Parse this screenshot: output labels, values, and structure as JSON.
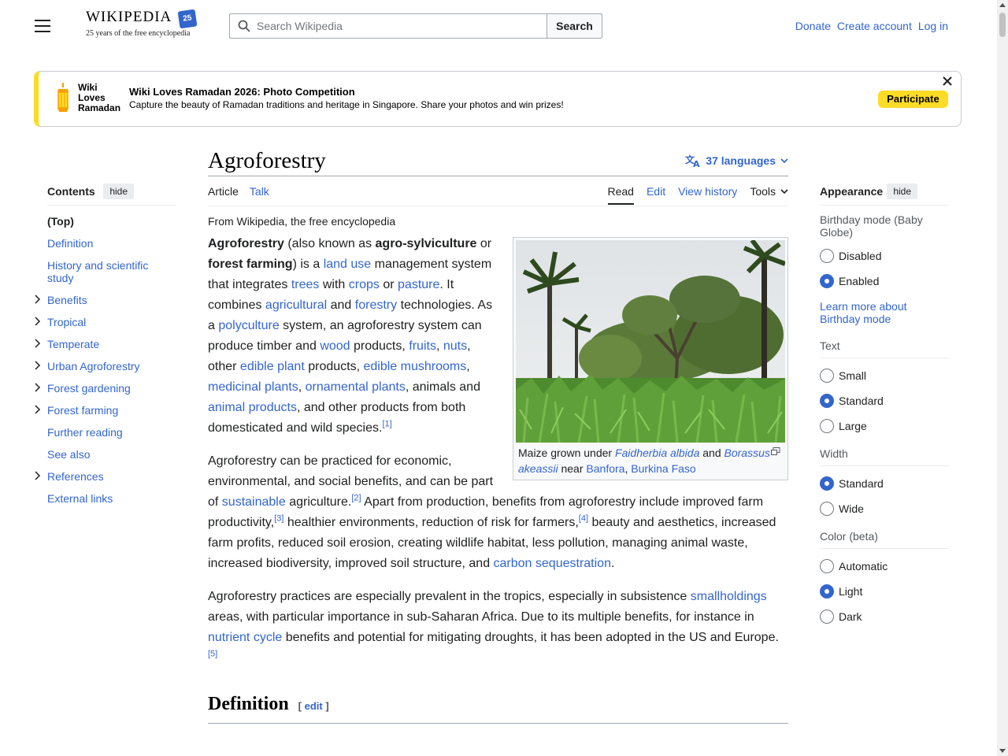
{
  "header": {
    "logo_word": "Wikipedia",
    "logo_tagline": "25 years of the free encyclopedia",
    "logo_badge": "25",
    "search_placeholder": "Search Wikipedia",
    "search_button": "Search",
    "user_links": [
      "Donate",
      "Create account",
      "Log in"
    ]
  },
  "banner": {
    "logo_lines": [
      "Wiki",
      "Loves",
      "Ramadan"
    ],
    "title": "Wiki Loves Ramadan 2026: Photo Competition",
    "description": "Capture the beauty of Ramadan traditions and heritage in Singapore. Share your photos and win prizes!",
    "button": "Participate"
  },
  "toc": {
    "title": "Contents",
    "hide": "hide",
    "items": [
      {
        "label": "(Top)",
        "expandable": false
      },
      {
        "label": "Definition",
        "expandable": false
      },
      {
        "label": "History and scientific study",
        "expandable": false
      },
      {
        "label": "Benefits",
        "expandable": true
      },
      {
        "label": "Tropical",
        "expandable": true
      },
      {
        "label": "Temperate",
        "expandable": true
      },
      {
        "label": "Urban Agroforestry",
        "expandable": true
      },
      {
        "label": "Forest gardening",
        "expandable": true
      },
      {
        "label": "Forest farming",
        "expandable": true
      },
      {
        "label": "Further reading",
        "expandable": false
      },
      {
        "label": "See also",
        "expandable": false
      },
      {
        "label": "References",
        "expandable": true
      },
      {
        "label": "External links",
        "expandable": false
      }
    ]
  },
  "article": {
    "title": "Agroforestry",
    "languages": "37 languages",
    "tabs_left": [
      "Article",
      "Talk"
    ],
    "tabs_right": [
      "Read",
      "Edit",
      "View history"
    ],
    "tools": "Tools",
    "tagline": "From Wikipedia, the free encyclopedia",
    "caption": {
      "t1": "Maize grown under ",
      "l1": "Faidherbia albida",
      "t2": " and ",
      "l2": "Borassus akeassii",
      "t3": " near ",
      "l3": "Banfora",
      "t4": ", ",
      "l4": "Burkina Faso"
    },
    "section_heading": "Definition",
    "edit_label": "edit"
  },
  "appearance": {
    "title": "Appearance",
    "hide": "hide",
    "birthday_label": "Birthday mode (Baby Globe)",
    "birthday_options": [
      {
        "label": "Disabled",
        "selected": false
      },
      {
        "label": "Enabled",
        "selected": true
      }
    ],
    "learn_more": "Learn more about Birthday mode",
    "text_label": "Text",
    "text_options": [
      {
        "label": "Small",
        "selected": false
      },
      {
        "label": "Standard",
        "selected": true
      },
      {
        "label": "Large",
        "selected": false
      }
    ],
    "width_label": "Width",
    "width_options": [
      {
        "label": "Standard",
        "selected": true
      },
      {
        "label": "Wide",
        "selected": false
      }
    ],
    "color_label": "Color (beta)",
    "color_options": [
      {
        "label": "Automatic",
        "selected": false
      },
      {
        "label": "Light",
        "selected": true
      },
      {
        "label": "Dark",
        "selected": false
      }
    ]
  }
}
